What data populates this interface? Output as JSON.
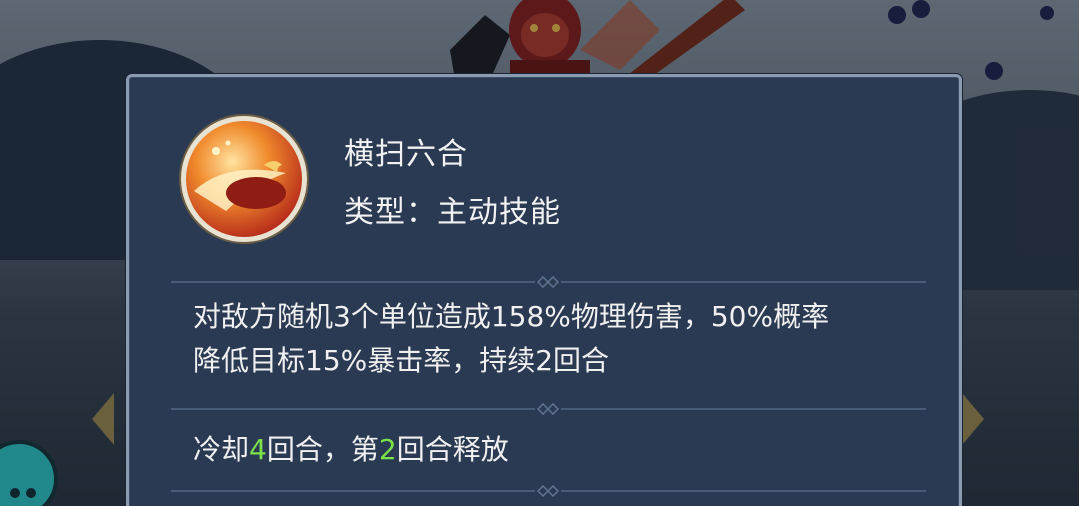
{
  "skill": {
    "name": "横扫六合",
    "type_text": "类型：主动技能",
    "description_line1": "对敌方随机3个单位造成158%物理伤害，50%概率",
    "description_line2": "降低目标15%暴击率，持续2回合",
    "cooldown": {
      "prefix": "冷却",
      "cooldown_rounds": "4",
      "middle": "回合，第",
      "release_round": "2",
      "suffix": "回合释放"
    }
  },
  "colors": {
    "panel_bg": "#2a3a52",
    "panel_border": "#8b9bb0",
    "text": "#f0f0f0",
    "highlight_number": "#7be34a"
  },
  "icons": {
    "skill_icon": "sweeping-slash-icon",
    "left_nav": "arrow-left-icon",
    "right_nav": "arrow-right-icon",
    "divider_ornament": "diamond-ornament-icon"
  }
}
